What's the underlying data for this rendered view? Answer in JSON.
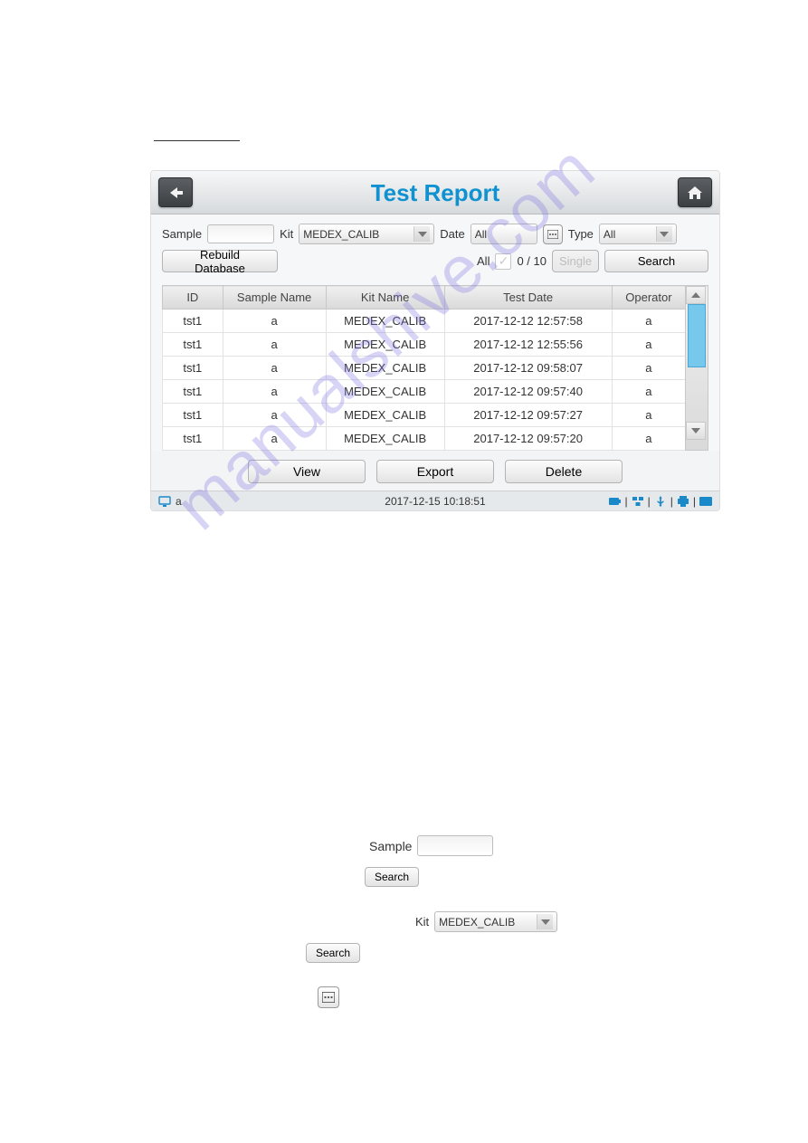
{
  "title": "Test Report",
  "filters": {
    "sample_label": "Sample",
    "sample_value": "",
    "kit_label": "Kit",
    "kit_value": "MEDEX_CALIB",
    "date_label": "Date",
    "date_value": "All",
    "type_label": "Type",
    "type_value": "All"
  },
  "actions": {
    "rebuild": "Rebuild Database",
    "all_label": "All",
    "counter": "0 / 10",
    "single": "Single",
    "search": "Search",
    "view": "View",
    "export": "Export",
    "delete": "Delete"
  },
  "columns": {
    "id": "ID",
    "sample_name": "Sample Name",
    "kit_name": "Kit Name",
    "test_date": "Test Date",
    "operator": "Operator"
  },
  "rows": [
    {
      "id": "tst1",
      "sample": "a",
      "kit": "MEDEX_CALIB",
      "date": "2017-12-12 12:57:58",
      "op": "a"
    },
    {
      "id": "tst1",
      "sample": "a",
      "kit": "MEDEX_CALIB",
      "date": "2017-12-12 12:55:56",
      "op": "a"
    },
    {
      "id": "tst1",
      "sample": "a",
      "kit": "MEDEX_CALIB",
      "date": "2017-12-12 09:58:07",
      "op": "a"
    },
    {
      "id": "tst1",
      "sample": "a",
      "kit": "MEDEX_CALIB",
      "date": "2017-12-12 09:57:40",
      "op": "a"
    },
    {
      "id": "tst1",
      "sample": "a",
      "kit": "MEDEX_CALIB",
      "date": "2017-12-12 09:57:27",
      "op": "a"
    },
    {
      "id": "tst1",
      "sample": "a",
      "kit": "MEDEX_CALIB",
      "date": "2017-12-12 09:57:20",
      "op": "a"
    }
  ],
  "status": {
    "user": "a",
    "datetime": "2017-12-15 10:18:51"
  },
  "watermark": "manualshive.com",
  "fragments": {
    "sample_label": "Sample",
    "search": "Search",
    "kit_label": "Kit",
    "kit_value": "MEDEX_CALIB"
  }
}
